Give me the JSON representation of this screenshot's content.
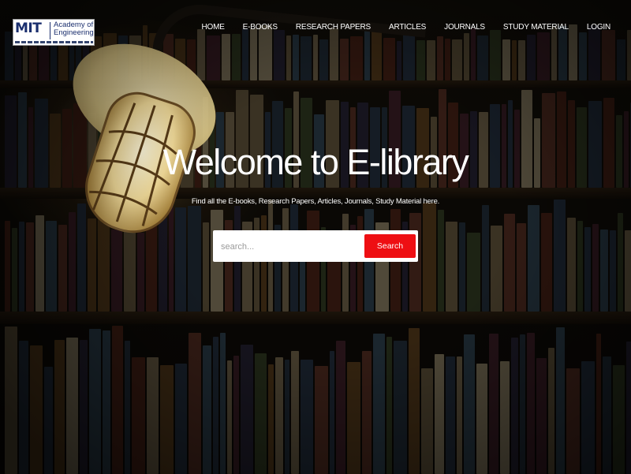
{
  "logo": {
    "short": "MIT",
    "line1": "Academy of",
    "line2": "Engineering"
  },
  "nav": {
    "items": [
      {
        "label": "HOME"
      },
      {
        "label": "E-BOOKS"
      },
      {
        "label": "RESEARCH PAPERS"
      },
      {
        "label": "ARTICLES"
      },
      {
        "label": "JOURNALS"
      },
      {
        "label": "STUDY MATERIAL"
      },
      {
        "label": "LOGIN"
      }
    ]
  },
  "hero": {
    "title": "Welcome to E-library",
    "subtitle": "Find all the E-books, Research Papers, Articles, Journals, Study Material here."
  },
  "search": {
    "placeholder": "search...",
    "value": "",
    "button_label": "Search"
  },
  "colors": {
    "accent": "#ee0f13",
    "text": "#ffffff",
    "logo_blue": "#1b2f6e"
  },
  "icons": {
    "background": "library-bookshelf-image",
    "lamp": "lamp-illustration"
  }
}
